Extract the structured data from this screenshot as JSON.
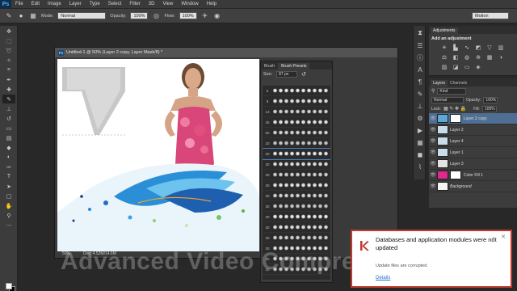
{
  "app": {
    "logo": "Ps"
  },
  "menu": [
    "File",
    "Edit",
    "Image",
    "Layer",
    "Type",
    "Select",
    "Filter",
    "3D",
    "View",
    "Window",
    "Help"
  ],
  "options_bar": {
    "mode_label": "Mode:",
    "mode_value": "Normal",
    "opacity_label": "Opacity:",
    "opacity_value": "100%",
    "flow_label": "Flow:",
    "flow_value": "100%",
    "workspace": "Motion"
  },
  "document": {
    "title": "Untitled-1 @ 50% (Layer 2 copy, Layer Mask/8) *",
    "zoom": "50%",
    "doc_info": "Doc: 4.52M/14.6M"
  },
  "brush_panel": {
    "tabs": [
      "Brush",
      "Brush Presets"
    ],
    "size_label": "Size:",
    "size_value": "87 px",
    "rows": [
      "5",
      "9",
      "13",
      "25",
      "50",
      "20",
      "30",
      "30",
      "30",
      "30",
      "30",
      "30",
      "30",
      "30",
      "30",
      "30",
      "30",
      "30"
    ]
  },
  "adjustments": {
    "tabs": [
      "Adjustments",
      ""
    ],
    "title": "Add an adjustment"
  },
  "layers": {
    "tabs": [
      "Layers",
      "Channels"
    ],
    "filter": "Kind",
    "blend": "Normal",
    "opacity_label": "Opacity:",
    "opacity_value": "100%",
    "lock_label": "Lock:",
    "fill_label": "Fill:",
    "fill_value": "100%",
    "items": [
      "Layer 2 copy",
      "Layer 2",
      "Layer 4",
      "Layer 1",
      "Layer 3",
      "Color Fill 1",
      "Background"
    ]
  },
  "watermark": "Advanced Video Compressor",
  "notification": {
    "title": "Databases and application modules were not updated",
    "body": "Update files are corrupted.",
    "link": "Details",
    "accent": "#c0392b"
  }
}
